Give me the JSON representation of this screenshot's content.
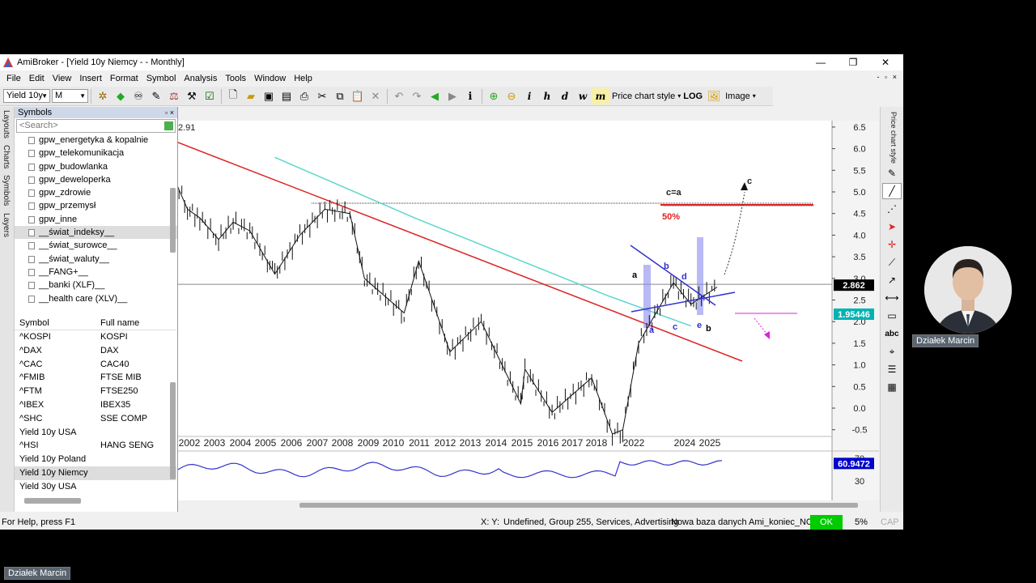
{
  "window": {
    "title": "AmiBroker - [Yield 10y Niemcy -  - Monthly]",
    "minimize": "—",
    "maximize": "❐",
    "close": "✕"
  },
  "menu": [
    "File",
    "Edit",
    "View",
    "Insert",
    "Format",
    "Symbol",
    "Analysis",
    "Tools",
    "Window",
    "Help"
  ],
  "mdi_controls": "- ▫ ×",
  "toolbar": {
    "symbol_combo": "Yield 10y",
    "interval_combo": "M",
    "price_chart_style": "Price chart style",
    "log_label": "LOG",
    "image_label": "Image",
    "italic_tools": [
      "i",
      "h",
      "d",
      "w",
      "m"
    ]
  },
  "left_dock_tabs": [
    "Layouts",
    "Charts",
    "Symbols",
    "Layers"
  ],
  "symbols_panel": {
    "title": "Symbols",
    "search_placeholder": "<Search>",
    "tree_items": [
      "gpw_energetyka & kopalnie",
      "gpw_telekomunikacja",
      "gpw_budowlanka",
      "gpw_deweloperka",
      "gpw_zdrowie",
      "gpw_przemysł",
      "gpw_inne",
      "__świat_indeksy__",
      "__świat_surowce__",
      "__świat_waluty__",
      "__FANG+__",
      "__banki (XLF)__",
      "__health care (XLV)__"
    ],
    "selected_tree_index": 7,
    "grid_headers": [
      "Symbol",
      "Full name"
    ],
    "grid_rows": [
      [
        "^KOSPI",
        "KOSPI"
      ],
      [
        "^DAX",
        "DAX"
      ],
      [
        "^CAC",
        "CAC40"
      ],
      [
        "^FMIB",
        "FTSE MIB"
      ],
      [
        "^FTM",
        "FTSE250"
      ],
      [
        "^IBEX",
        "IBEX35"
      ],
      [
        "^SHC",
        "SSE COMP"
      ],
      [
        "Yield 10y USA",
        ""
      ],
      [
        "^HSI",
        "HANG SENG"
      ],
      [
        "Yield 10y Poland",
        ""
      ],
      [
        "Yield 10y Niemcy",
        ""
      ],
      [
        "Yield 30y USA",
        ""
      ]
    ],
    "selected_grid_index": 10
  },
  "right_dock": {
    "vertical_label": "Price chart style"
  },
  "chart": {
    "top_left_value": "2.91",
    "price_label": "2.862",
    "price_label_color": "#000000",
    "support_label": "1.95446",
    "support_label_color": "#00b3b3",
    "rsi_label": "60.9472",
    "rsi_label_color": "#0000cc",
    "annotations": {
      "c_eq_a": "c=a",
      "fifty_pct": "50%",
      "c_top": "c",
      "wave_letters": [
        "a",
        "b",
        "d",
        "a",
        "c",
        "e",
        "b"
      ]
    }
  },
  "chart_data": {
    "type": "candlestick",
    "title": "Yield 10y Niemcy -  - Monthly",
    "x_ticks": [
      "2002",
      "2003",
      "2004",
      "2005",
      "2006",
      "2007",
      "2008",
      "2009",
      "2010",
      "2011",
      "2012",
      "2013",
      "2014",
      "2015",
      "2016",
      "2017",
      "2018",
      "2022",
      "2024",
      "2025"
    ],
    "y_ticks": [
      "0.0",
      "0.5",
      "1.0",
      "1.5",
      "2.0",
      "2.5",
      "3.0",
      "3.5",
      "4.0",
      "4.5",
      "5.0",
      "5.5",
      "6.0",
      "6.5",
      "-0.5"
    ],
    "ylim": [
      -0.6,
      6.6
    ],
    "close_path": [
      {
        "x": "2001-06",
        "y": 5.2
      },
      {
        "x": "2001-12",
        "y": 4.6
      },
      {
        "x": "2002-06",
        "y": 4.4
      },
      {
        "x": "2003-03",
        "y": 3.9
      },
      {
        "x": "2003-10",
        "y": 4.3
      },
      {
        "x": "2004-06",
        "y": 4.1
      },
      {
        "x": "2005-06",
        "y": 3.1
      },
      {
        "x": "2006-06",
        "y": 4.0
      },
      {
        "x": "2007-06",
        "y": 4.6
      },
      {
        "x": "2008-06",
        "y": 4.5
      },
      {
        "x": "2009-01",
        "y": 3.0
      },
      {
        "x": "2010-08",
        "y": 2.2
      },
      {
        "x": "2011-03",
        "y": 3.4
      },
      {
        "x": "2012-06",
        "y": 1.3
      },
      {
        "x": "2013-09",
        "y": 2.0
      },
      {
        "x": "2015-04",
        "y": 0.1
      },
      {
        "x": "2015-06",
        "y": 0.9
      },
      {
        "x": "2016-07",
        "y": -0.1
      },
      {
        "x": "2018-02",
        "y": 0.7
      },
      {
        "x": "2019-08",
        "y": -0.6
      },
      {
        "x": "2020-12",
        "y": -0.5
      },
      {
        "x": "2022-06",
        "y": 1.5
      },
      {
        "x": "2023-10",
        "y": 2.9
      },
      {
        "x": "2024-06",
        "y": 2.4
      },
      {
        "x": "2025-06",
        "y": 2.8
      }
    ],
    "ma_line": [
      {
        "x": "2005-06",
        "y": 5.8
      },
      {
        "x": "2011-01",
        "y": 4.4
      },
      {
        "x": "2019-01",
        "y": 2.6
      },
      {
        "x": "2024-06",
        "y": 1.9
      }
    ],
    "horizontal_line": 2.862,
    "upper_target_line": 4.7,
    "rsi_value": 60.9472,
    "rsi_ticks": [
      "70",
      "30"
    ]
  },
  "status": {
    "help": "For Help, press F1",
    "xy": "X: Y:",
    "group": "Undefined, Group 255, Services, Advertising",
    "db": "Nowa baza danych Ami_koniec_NOL",
    "ok": "OK",
    "zoom": "5%",
    "cap": "CAP"
  },
  "presenter": {
    "name": "Działek Marcin"
  }
}
